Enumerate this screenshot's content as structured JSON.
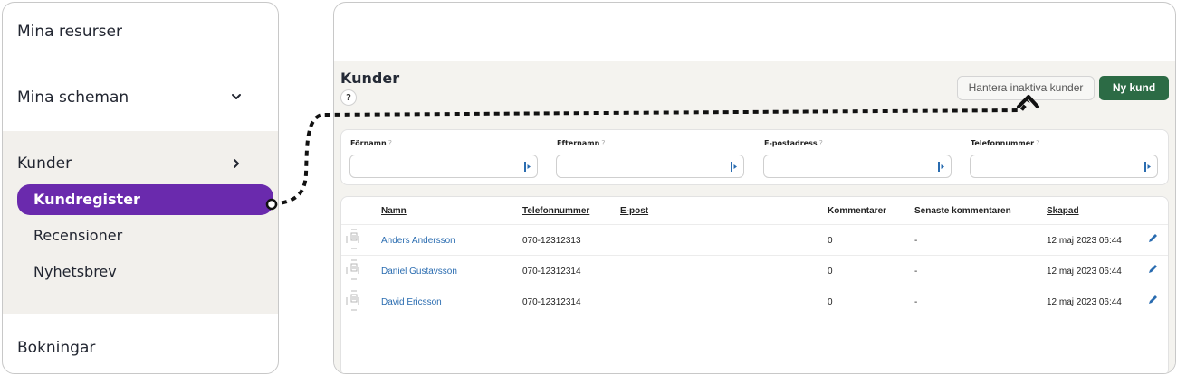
{
  "sidebar": {
    "items": [
      {
        "label": "Mina resurser"
      },
      {
        "label": "Mina scheman"
      },
      {
        "label": "Kunder"
      },
      {
        "label": "Bokningar"
      }
    ],
    "subitems": [
      {
        "label": "Kundregister",
        "active": true
      },
      {
        "label": "Recensioner"
      },
      {
        "label": "Nyhetsbrev"
      }
    ],
    "active_color": "#6a2aad"
  },
  "header": {
    "title": "Kunder",
    "help": "?",
    "inactive_button": "Hantera inaktiva kunder",
    "new_button": "Ny kund",
    "new_button_color": "#2c6b45"
  },
  "filters": [
    {
      "label": "Förnamn",
      "hint": "?",
      "value": ""
    },
    {
      "label": "Efternamn",
      "hint": "?",
      "value": ""
    },
    {
      "label": "E-postadress",
      "hint": "?",
      "value": ""
    },
    {
      "label": "Telefonnummer",
      "hint": "?",
      "value": ""
    }
  ],
  "table": {
    "columns": [
      "Namn",
      "Telefonnummer",
      "E-post",
      "Kommentarer",
      "Senaste kommentaren",
      "Skapad"
    ],
    "rows": [
      {
        "name": "Anders Andersson",
        "phone": "070-12312313",
        "email": "",
        "comments": "0",
        "last_comment": "-",
        "created": "12 maj 2023 06:44"
      },
      {
        "name": "Daniel Gustavsson",
        "phone": "070-12312314",
        "email": "",
        "comments": "0",
        "last_comment": "-",
        "created": "12 maj 2023 06:44"
      },
      {
        "name": "David Ericsson",
        "phone": "070-12312314",
        "email": "",
        "comments": "0",
        "last_comment": "-",
        "created": "12 maj 2023 06:44"
      }
    ]
  },
  "icons": {
    "chevron_down": "chevron-down-icon",
    "chevron_right": "chevron-right-icon",
    "edit": "pencil-icon",
    "field": "input-autofill-icon",
    "row": "customer-card-icon"
  }
}
